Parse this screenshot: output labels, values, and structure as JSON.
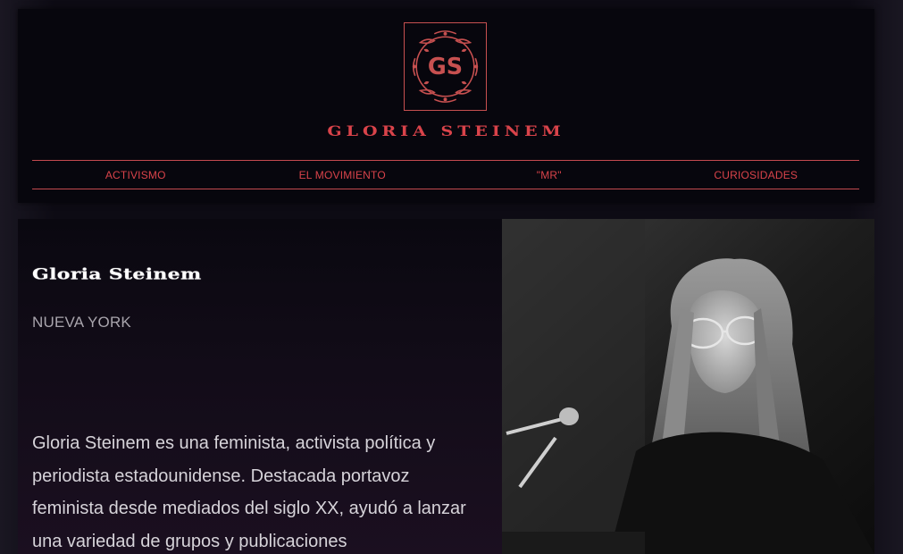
{
  "header": {
    "logo_text": "GS",
    "site_title": "GLORIA STEINEM"
  },
  "nav": {
    "items": [
      {
        "label": "ACTIVISMO"
      },
      {
        "label": "EL MOVIMIENTO"
      },
      {
        "label": "\"MR\""
      },
      {
        "label": "CURIOSIDADES"
      }
    ]
  },
  "main": {
    "heading": "Gloria Steinem",
    "location": "NUEVA YORK",
    "bio": "Gloria Steinem es una feminista, activista política y periodista estadounidense. Destacada portavoz feminista desde mediados del siglo XX, ayudó a lanzar una variedad de grupos y publicaciones"
  },
  "colors": {
    "accent": "#d9434a",
    "background": "#07060d",
    "text_light": "#d6d3d9",
    "text_muted": "#a9a5ad"
  },
  "icons": {
    "logo": "gs-monogram-logo",
    "photo": "portrait-photo"
  }
}
